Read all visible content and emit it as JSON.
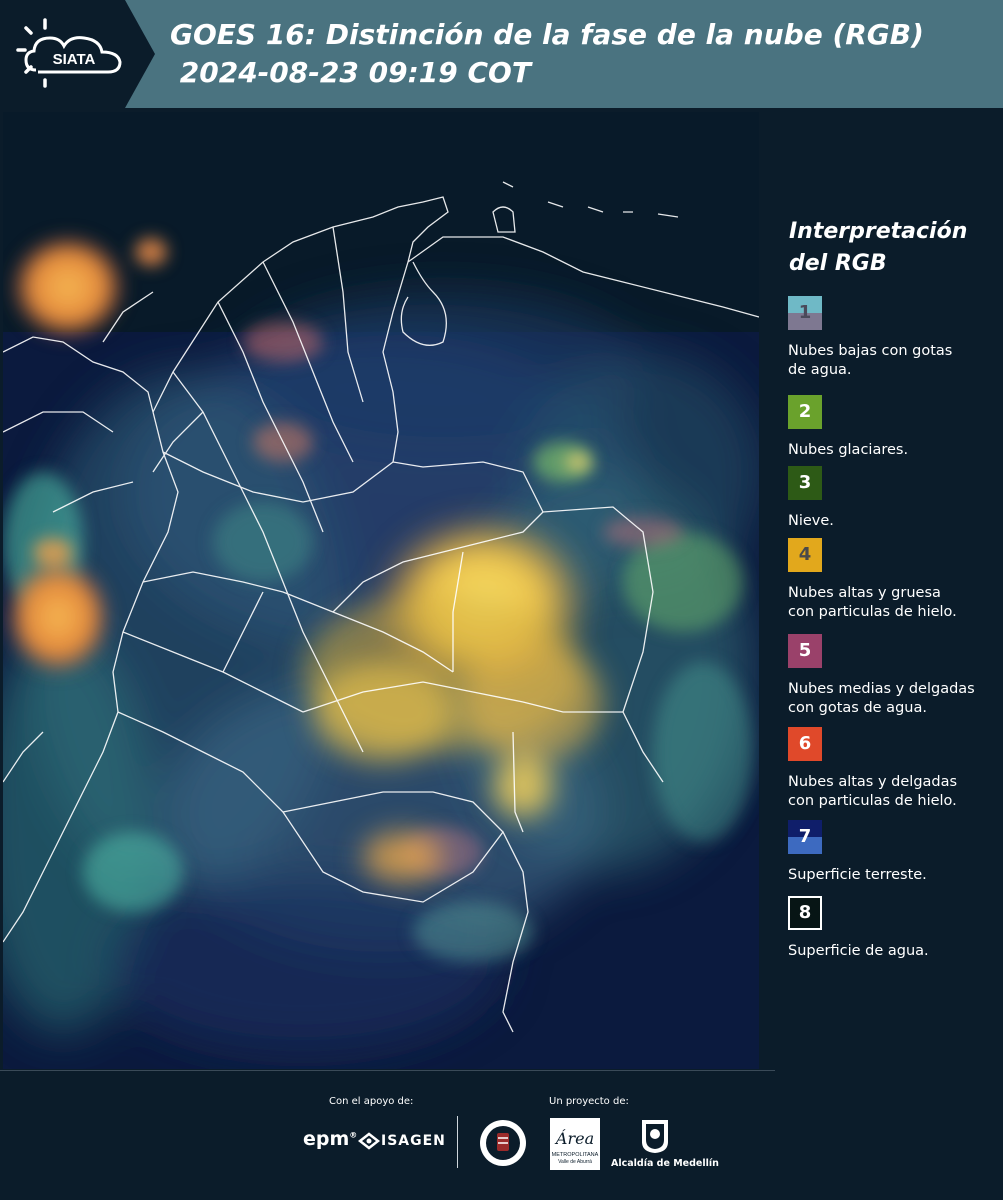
{
  "header": {
    "logo_text": "SIATA",
    "title_line1": "GOES 16: Distinción de la fase de la nube (RGB)",
    "title_line2": " 2024-08-23 09:19 COT"
  },
  "legend": {
    "title_line1": "Interpretación",
    "title_line2": "del RGB",
    "items": [
      {
        "number": "1",
        "label_line1": "Nubes bajas con gotas",
        "label_line2": "de agua.",
        "color_top": "#6fb9c6",
        "color_bottom": "#7e7891",
        "num_color": "#4a4a5a"
      },
      {
        "number": "2",
        "label_line1": "Nubes glaciares.",
        "label_line2": "",
        "color_top": "#6aa22c",
        "color_bottom": "#6aa22c",
        "num_color": "#ffffff"
      },
      {
        "number": "3",
        "label_line1": "Nieve.",
        "label_line2": "",
        "color_top": "#2d5a16",
        "color_bottom": "#2d5a16",
        "num_color": "#ffffff"
      },
      {
        "number": "4",
        "label_line1": "Nubes altas y gruesa",
        "label_line2": "con particulas de hielo.",
        "color_top": "#e2a81c",
        "color_bottom": "#e2a81c",
        "num_color": "#4a4a4a"
      },
      {
        "number": "5",
        "label_line1": "Nubes medias y delgadas",
        "label_line2": "con gotas de agua.",
        "color_top": "#9a416a",
        "color_bottom": "#9a416a",
        "num_color": "#ffffff"
      },
      {
        "number": "6",
        "label_line1": "Nubes altas y delgadas",
        "label_line2": "con particulas de hielo.",
        "color_top": "#e0492a",
        "color_bottom": "#e0492a",
        "num_color": "#ffffff"
      },
      {
        "number": "7",
        "label_line1": "Superficie terreste.",
        "label_line2": "",
        "color_top": "#0f1e6a",
        "color_bottom": "#3d6ac0",
        "num_color": "#ffffff"
      },
      {
        "number": "8",
        "label_line1": "Superficie de agua.",
        "label_line2": "",
        "color_top": "#071515",
        "color_bottom": "#071515",
        "num_color": "#ffffff"
      }
    ]
  },
  "footer": {
    "support_label": "Con el apoyo de:",
    "project_label": "Un proyecto de:",
    "epm": "epm",
    "isagen": "ISAGEN",
    "area_text": "Área",
    "area_sub1": "METROPOLITANA",
    "area_sub2": "Valle de Aburrá",
    "alcaldia": "Alcaldía de Medellín"
  }
}
